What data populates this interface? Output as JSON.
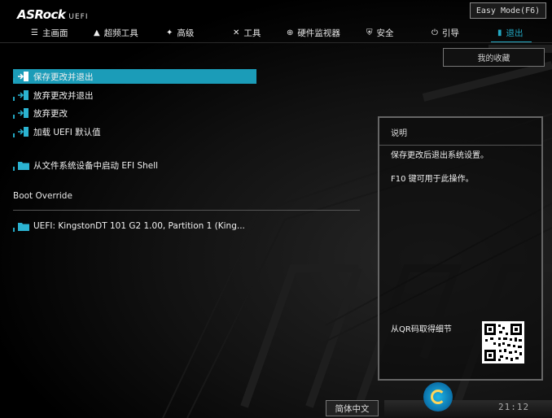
{
  "header": {
    "brand": "ASRock",
    "brand_sub": "UEFI",
    "easy_mode_label": "Easy Mode(F6)",
    "favorites_label": "我的收藏"
  },
  "tabs": [
    {
      "label": "主画面",
      "icon": "list-icon"
    },
    {
      "label": "超频工具",
      "icon": "rocket-icon"
    },
    {
      "label": "高级",
      "icon": "star-icon"
    },
    {
      "label": "工具",
      "icon": "tools-icon"
    },
    {
      "label": "硬件监视器",
      "icon": "monitor-icon"
    },
    {
      "label": "安全",
      "icon": "shield-icon"
    },
    {
      "label": "引导",
      "icon": "power-icon"
    },
    {
      "label": "退出",
      "icon": "exit-icon",
      "active": true
    }
  ],
  "menu": {
    "items": [
      {
        "label": "保存更改并退出",
        "icon": "exit-door-icon",
        "selected": true
      },
      {
        "label": "放弃更改并退出",
        "icon": "exit-door-icon"
      },
      {
        "label": "放弃更改",
        "icon": "exit-door-icon"
      },
      {
        "label": "加载 UEFI 默认值",
        "icon": "exit-door-icon"
      },
      {
        "label": "从文件系统设备中启动 EFI Shell",
        "icon": "folder-icon"
      }
    ],
    "section_title": "Boot Override",
    "boot_items": [
      {
        "label": "UEFI: KingstonDT 101 G2 1.00, Partition 1 (King...",
        "icon": "folder-icon"
      }
    ]
  },
  "description": {
    "title": "说明",
    "line1": "保存更改后退出系统设置。",
    "line2": "F10 键可用于此操作。",
    "qr_text": "从QR码取得细节"
  },
  "footer": {
    "language": "简体中文",
    "clock": "21:12"
  },
  "colors": {
    "accent": "#1b9cb8",
    "background": "#000000"
  }
}
